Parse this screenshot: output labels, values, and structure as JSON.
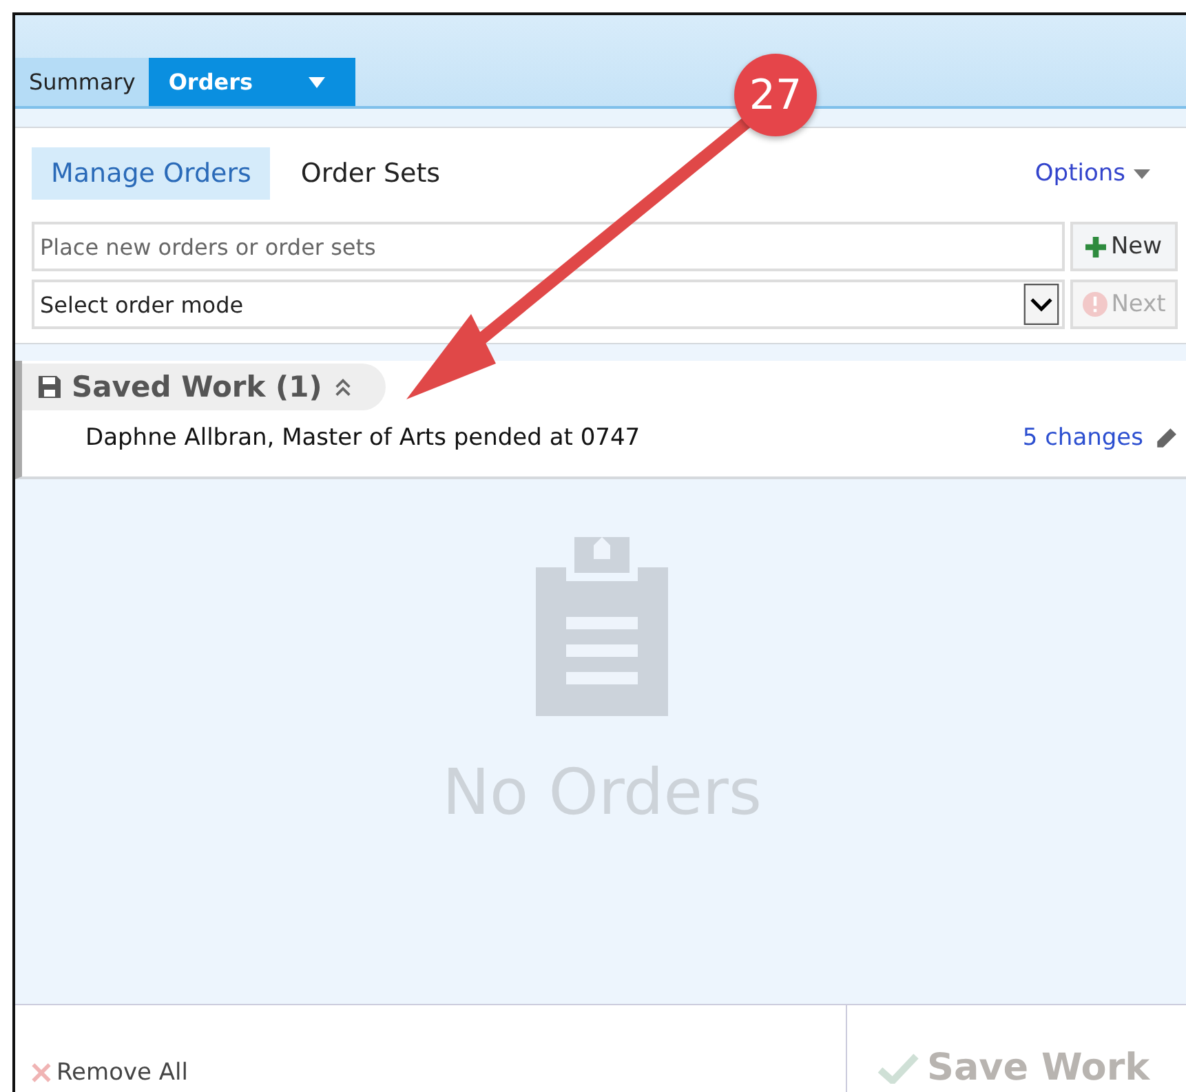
{
  "tabs": [
    {
      "label": "Summary",
      "selected": false
    },
    {
      "label": "Orders",
      "selected": true,
      "has_menu": true
    }
  ],
  "subtabs": [
    {
      "label": "Manage Orders",
      "selected": true
    },
    {
      "label": "Order Sets",
      "selected": false
    }
  ],
  "options_link": "Options",
  "order_search": {
    "placeholder": "Place new orders or order sets"
  },
  "new_button": {
    "label": "New",
    "disabled": false
  },
  "order_mode": {
    "value": "Select order mode"
  },
  "next_button": {
    "label": "Next",
    "disabled": true
  },
  "saved_work": {
    "title": "Saved Work (1)",
    "expanded": true,
    "items": [
      {
        "text": "Daphne Allbran, Master of Arts pended at 0747",
        "changes": "5 changes"
      }
    ]
  },
  "empty_state": {
    "message": "No Orders"
  },
  "footer": {
    "remove_all": "Remove All",
    "save_work": {
      "label": "Save Work",
      "disabled": true
    }
  },
  "callout": {
    "number": "27"
  }
}
